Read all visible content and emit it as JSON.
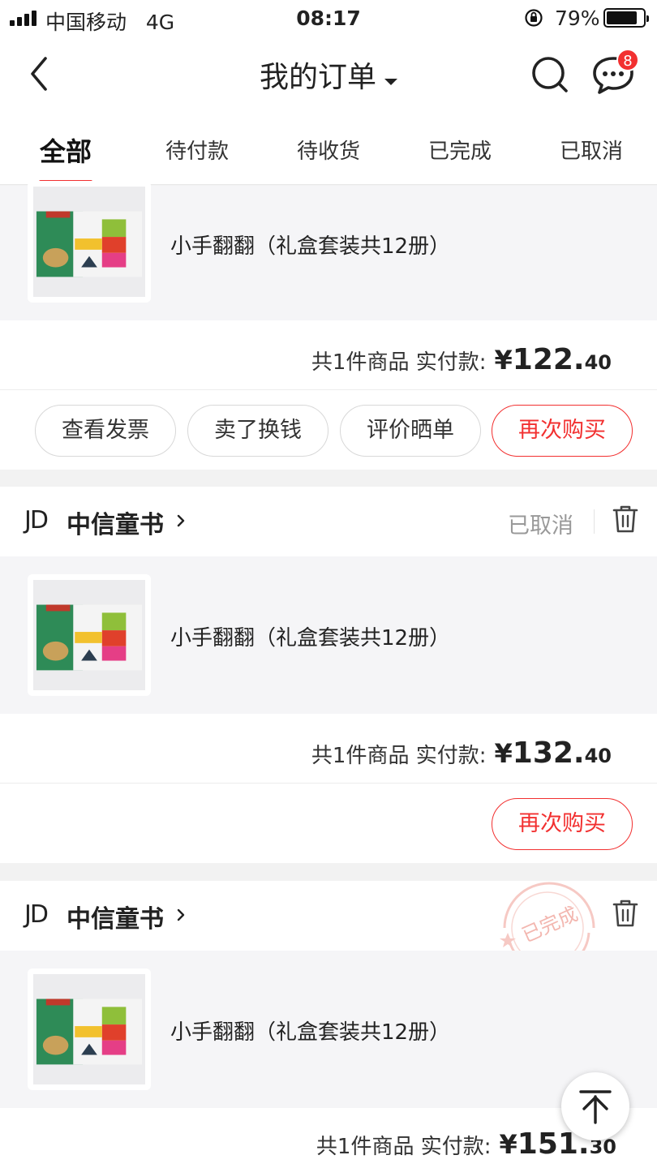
{
  "status_bar": {
    "carrier": "中国移动",
    "network": "4G",
    "time": "08:17",
    "battery": "79%"
  },
  "header": {
    "title": "我的订单",
    "message_badge": "8",
    "icons": [
      "back-icon",
      "search-icon",
      "message-icon"
    ]
  },
  "tabs": [
    {
      "label": "全部",
      "active": true
    },
    {
      "label": "待付款",
      "active": false
    },
    {
      "label": "待收货",
      "active": false
    },
    {
      "label": "已完成",
      "active": false
    },
    {
      "label": "已取消",
      "active": false
    }
  ],
  "orders": [
    {
      "goods_name": "小手翻翻（礼盒套装共12册）",
      "summary_label": "共1件商品  实付款:",
      "price_yen": "¥",
      "price_int": "122.",
      "price_dec": "40",
      "buttons": [
        "查看发票",
        "卖了换钱",
        "评价晒单",
        "再次购买"
      ]
    },
    {
      "shop_logo": "JD",
      "shop_name": "中信童书",
      "status": "已取消",
      "goods_name": "小手翻翻（礼盒套装共12册）",
      "summary_label": "共1件商品  实付款:",
      "price_yen": "¥",
      "price_int": "132.",
      "price_dec": "40",
      "buttons": [
        "再次购买"
      ]
    },
    {
      "shop_logo": "JD",
      "shop_name": "中信童书",
      "stamp_text": "已完成",
      "goods_name": "小手翻翻（礼盒套装共12册）",
      "summary_label": "共1件商品  实付款:",
      "price_yen": "¥",
      "price_int": "151.",
      "price_dec": "30"
    }
  ],
  "colors": {
    "accent": "#f23030",
    "muted": "#999999",
    "background": "#f2f2f2"
  }
}
